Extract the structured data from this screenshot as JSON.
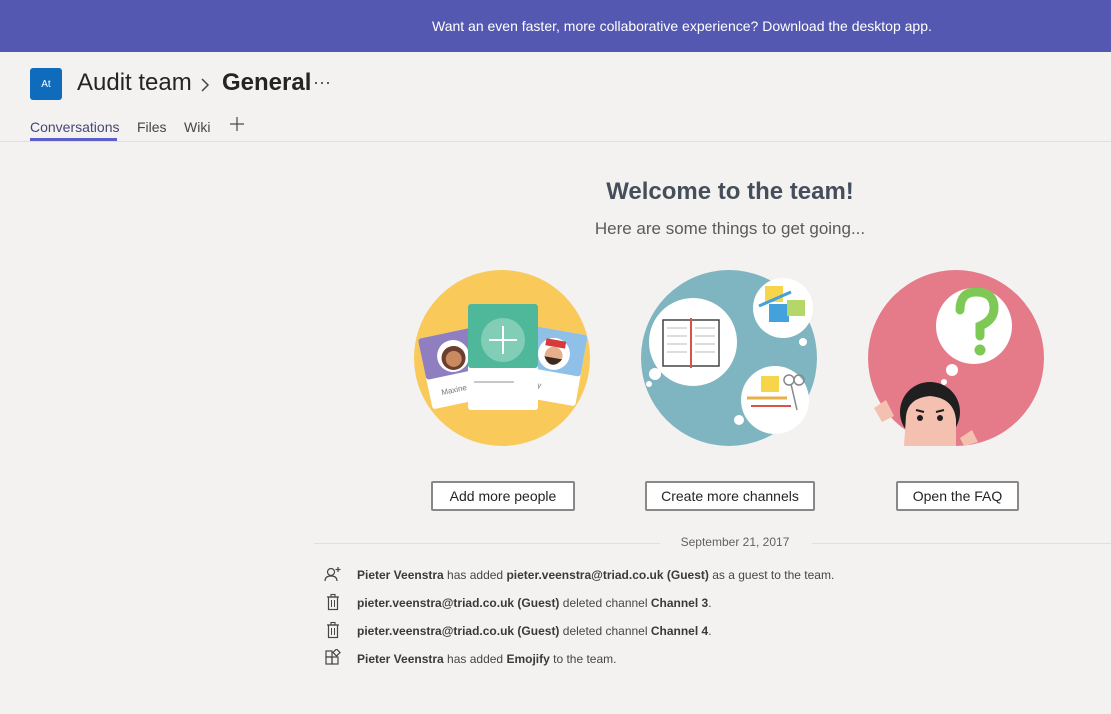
{
  "banner": {
    "text": "Want an even faster, more collaborative experience? Download the desktop app."
  },
  "header": {
    "team_initials": "At",
    "team_name": "Audit team",
    "channel_name": "General",
    "more_label": "···"
  },
  "tabs": [
    {
      "label": "Conversations",
      "active": true
    },
    {
      "label": "Files",
      "active": false
    },
    {
      "label": "Wiki",
      "active": false
    }
  ],
  "welcome": {
    "title": "Welcome to the team!",
    "subtitle": "Here are some things to get going...",
    "illustration_names": [
      "Maxine",
      "ky"
    ]
  },
  "actions": {
    "add_people": "Add more people",
    "create_channels": "Create more channels",
    "open_faq": "Open the FAQ"
  },
  "feed": {
    "date": "September 21, 2017",
    "events": [
      {
        "icon": "add-guest-icon",
        "parts": [
          {
            "t": "Pieter Veenstra",
            "b": true
          },
          {
            "t": " has added ",
            "b": false
          },
          {
            "t": "pieter.veenstra@triad.co.uk (Guest)",
            "b": true
          },
          {
            "t": " as a guest to the team.",
            "b": false
          }
        ]
      },
      {
        "icon": "trash-icon",
        "parts": [
          {
            "t": "pieter.veenstra@triad.co.uk (Guest)",
            "b": true
          },
          {
            "t": " deleted channel ",
            "b": false
          },
          {
            "t": "Channel 3",
            "b": true
          },
          {
            "t": ".",
            "b": false
          }
        ]
      },
      {
        "icon": "trash-icon",
        "parts": [
          {
            "t": "pieter.veenstra@triad.co.uk (Guest)",
            "b": true
          },
          {
            "t": " deleted channel ",
            "b": false
          },
          {
            "t": "Channel 4",
            "b": true
          },
          {
            "t": ".",
            "b": false
          }
        ]
      },
      {
        "icon": "app-icon",
        "parts": [
          {
            "t": "Pieter Veenstra",
            "b": true
          },
          {
            "t": " has added ",
            "b": false
          },
          {
            "t": "Emojify",
            "b": true
          },
          {
            "t": " to the team.",
            "b": false
          }
        ]
      }
    ]
  },
  "colors": {
    "banner": "#5458b0",
    "accent": "#5b5fc7",
    "yellow_circle": "#f9c95a",
    "teal_circle": "#7fb5c0",
    "pink_circle": "#e57a89"
  }
}
